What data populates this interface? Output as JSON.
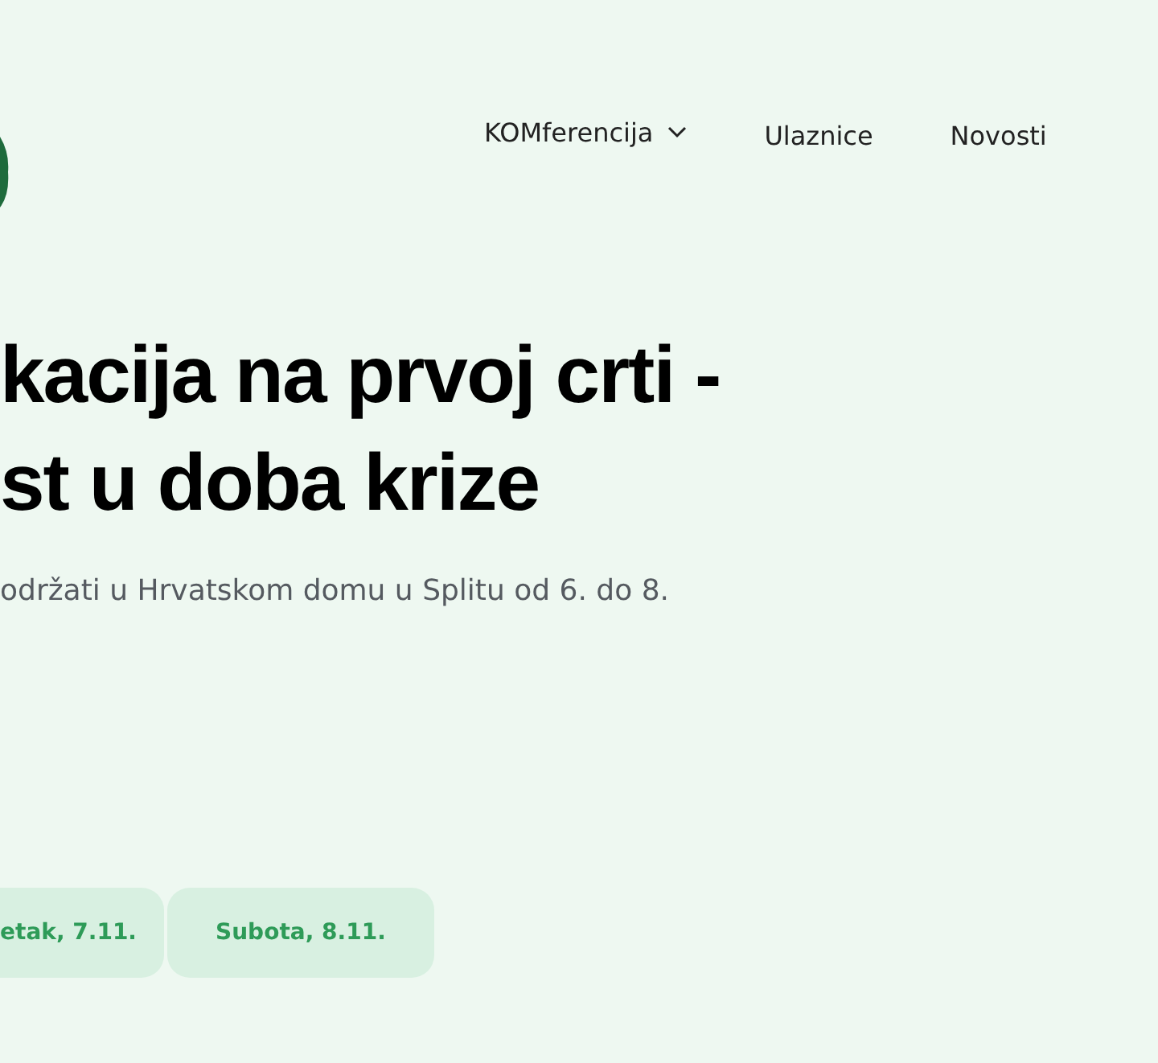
{
  "nav": [
    {
      "label": "KOMferencija",
      "dropdown": true
    },
    {
      "label": "Ulaznice",
      "dropdown": false
    },
    {
      "label": "Novosti",
      "dropdown": false
    }
  ],
  "hero": {
    "title_lines": [
      "kacija na prvoj crti -",
      "st u doba krize"
    ],
    "subtitle": "održati u Hrvatskom domu u Splitu od 6. do 8."
  },
  "day_tabs": [
    {
      "label": "etak, 7.11.",
      "selected": false
    },
    {
      "label": "Subota, 8.11.",
      "selected": false
    }
  ]
}
